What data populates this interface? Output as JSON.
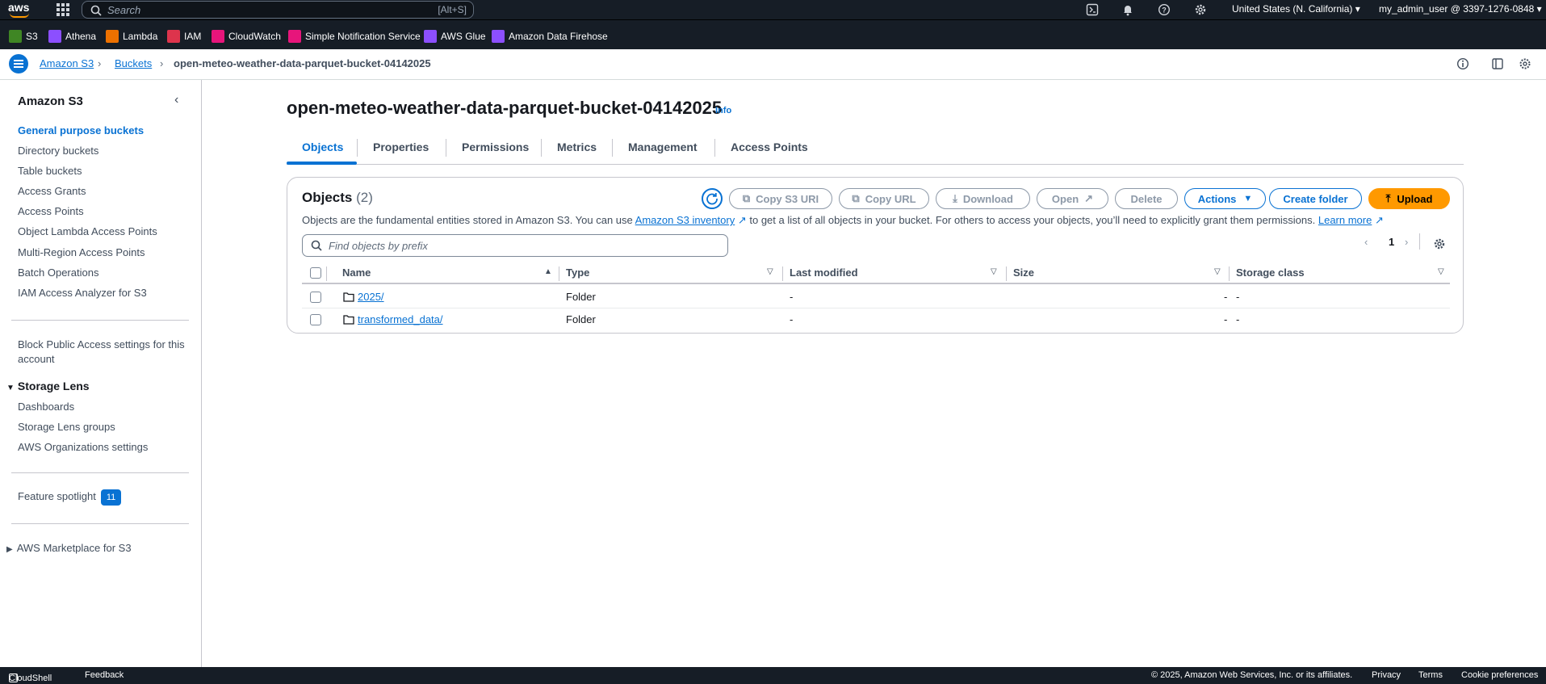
{
  "topbar": {
    "logo": "aws",
    "search_placeholder": "Search",
    "search_shortcut": "[Alt+S]",
    "region": "United States (N. California)",
    "user": "my_admin_user @ 3397-1276-0848",
    "icons": [
      "cloudshell-icon",
      "bell-icon",
      "help-icon",
      "settings-icon"
    ]
  },
  "favorites": [
    {
      "label": "S3",
      "color": "#3f8624"
    },
    {
      "label": "Athena",
      "color": "#8c4fff"
    },
    {
      "label": "Lambda",
      "color": "#ed7100"
    },
    {
      "label": "IAM",
      "color": "#dd344c"
    },
    {
      "label": "CloudWatch",
      "color": "#e7157b"
    },
    {
      "label": "Simple Notification Service",
      "color": "#e7157b"
    },
    {
      "label": "AWS Glue",
      "color": "#8c4fff"
    },
    {
      "label": "Amazon Data Firehose",
      "color": "#8c4fff"
    }
  ],
  "breadcrumb": {
    "items": [
      "Amazon S3",
      "Buckets",
      "open-meteo-weather-data-parquet-bucket-04142025"
    ]
  },
  "sidebar": {
    "title": "Amazon S3",
    "items": [
      "General purpose buckets",
      "Directory buckets",
      "Table buckets",
      "Access Grants",
      "Access Points",
      "Object Lambda Access Points",
      "Multi-Region Access Points",
      "Batch Operations",
      "IAM Access Analyzer for S3"
    ],
    "block_public": "Block Public Access settings for this account",
    "storage_lens": {
      "title": "Storage Lens",
      "items": [
        "Dashboards",
        "Storage Lens groups",
        "AWS Organizations settings"
      ]
    },
    "feature_spotlight": "Feature spotlight",
    "feature_count": "11",
    "marketplace": "AWS Marketplace for S3"
  },
  "main": {
    "title": "open-meteo-weather-data-parquet-bucket-04142025",
    "info": "Info",
    "tabs": [
      "Objects",
      "Properties",
      "Permissions",
      "Metrics",
      "Management",
      "Access Points"
    ]
  },
  "objects": {
    "title": "Objects",
    "count": "(2)",
    "desc_before": "Objects are the fundamental entities stored in Amazon S3. You can use ",
    "desc_link": "Amazon S3 inventory",
    "desc_after": " to get a list of all objects in your bucket. For others to access your objects, you’ll need to explicitly grant them permissions. ",
    "learn_more": "Learn more",
    "buttons": {
      "copy_uri": "Copy S3 URI",
      "copy_url": "Copy URL",
      "download": "Download",
      "open": "Open",
      "delete": "Delete",
      "actions": "Actions",
      "create_folder": "Create folder",
      "upload": "Upload"
    },
    "filter_placeholder": "Find objects by prefix",
    "page": "1",
    "columns": [
      "Name",
      "Type",
      "Last modified",
      "Size",
      "Storage class"
    ],
    "rows": [
      {
        "name": "2025/",
        "type": "Folder",
        "modified": "-",
        "size": "-",
        "class": "-"
      },
      {
        "name": "transformed_data/",
        "type": "Folder",
        "modified": "-",
        "size": "-",
        "class": "-"
      }
    ]
  },
  "footer": {
    "cloudshell": "CloudShell",
    "feedback": "Feedback",
    "copyright": "© 2025, Amazon Web Services, Inc. or its affiliates.",
    "privacy": "Privacy",
    "terms": "Terms",
    "cookies": "Cookie preferences"
  }
}
